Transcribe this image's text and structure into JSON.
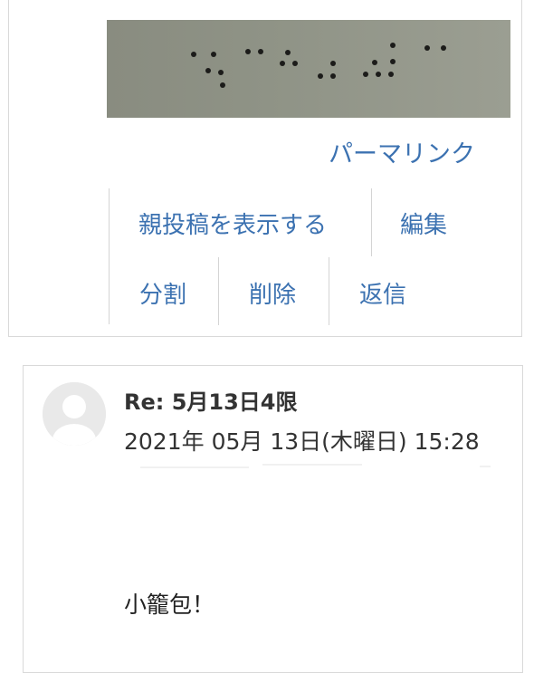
{
  "post": {
    "image_alt": "braille-photo",
    "permalink_label": "パーマリンク",
    "commands": {
      "show_parent": "親投稿を表示する",
      "edit": "編集",
      "split": "分割",
      "delete": "削除",
      "reply": "返信"
    }
  },
  "reply": {
    "subject": "Re: 5月13日4限",
    "date": "2021年 05月 13日(木曜日) 15:28",
    "body": "小籠包！"
  },
  "colors": {
    "link": "#3c72b1",
    "border": "#d9d9d9",
    "text": "#333333"
  },
  "icons": {
    "avatar": "default-user-avatar-icon"
  }
}
